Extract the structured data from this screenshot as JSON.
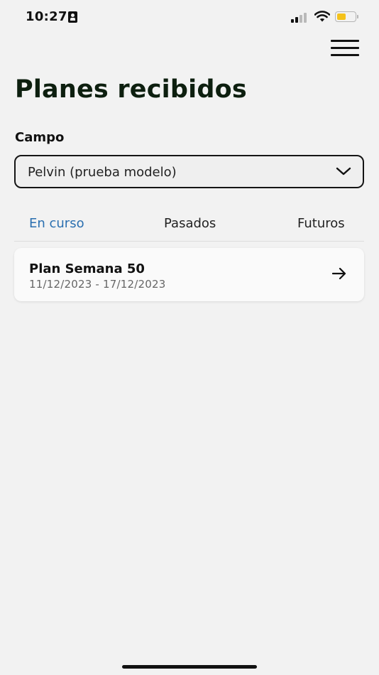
{
  "status_bar": {
    "time": "10:27",
    "icons": [
      "contact-card-icon",
      "cellular-signal-icon",
      "wifi-icon",
      "battery-icon"
    ],
    "battery_level": 0.5,
    "colors": {
      "battery": "#f4c21b"
    }
  },
  "header": {
    "menu_icon": "hamburger-menu-icon",
    "title": "Planes recibidos"
  },
  "field": {
    "label": "Campo",
    "selected_value": "Pelvin (prueba modelo)",
    "icon": "chevron-down-icon"
  },
  "tabs": [
    {
      "label": "En curso",
      "active": true
    },
    {
      "label": "Pasados",
      "active": false
    },
    {
      "label": "Futuros",
      "active": false
    }
  ],
  "plans": [
    {
      "title": "Plan Semana 50",
      "dates": "11/12/2023 - 17/12/2023",
      "icon": "arrow-right-icon"
    }
  ],
  "colors": {
    "accent": "#2a6fb0",
    "title": "#0d1f0f",
    "background": "#f2f2f2"
  }
}
